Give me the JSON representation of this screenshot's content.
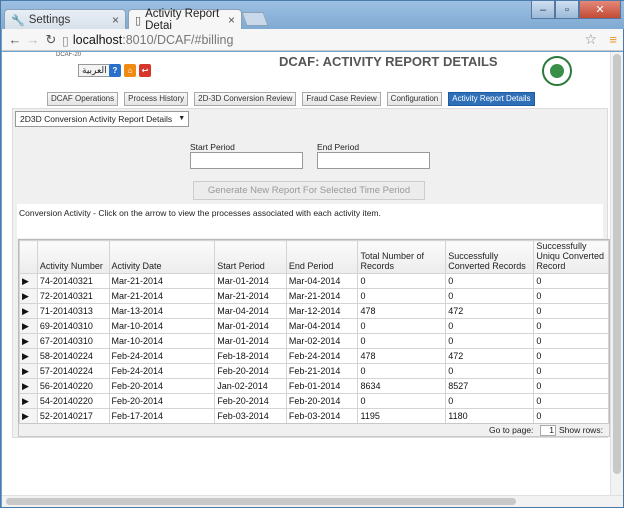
{
  "browser": {
    "tabs": [
      {
        "label": "Settings",
        "icon": "wrench-icon"
      },
      {
        "label": "Activity Report Detai",
        "icon": "page-icon"
      }
    ],
    "url_host": "localhost",
    "url_path": ":8010/DCAF/#billing"
  },
  "header": {
    "app_small": "DCAF-20",
    "lang_button": "العربية",
    "title": "DCAF: ACTIVITY REPORT DETAILS"
  },
  "nav": {
    "items": [
      "DCAF Operations",
      "Process History",
      "2D-3D Conversion Review",
      "Fraud Case Review",
      "Configuration",
      "Activity Report Details"
    ],
    "active": "Activity Report Details"
  },
  "form": {
    "report_type": "2D3D Conversion Activity Report Details",
    "start_label": "Start Period",
    "end_label": "End Period",
    "generate_button": "Generate New Report For Selected Time Period",
    "info_text": "Conversion Activity - Click on the arrow to view the processes associated with each activity item."
  },
  "table": {
    "columns": [
      "Activity Number",
      "Activity Date",
      "Start Period",
      "End Period",
      "Total Number of Records",
      "Successfully Converted Records",
      "Successfully Uniqu Converted Record"
    ],
    "rows": [
      [
        "74-20140321",
        "Mar-21-2014",
        "Mar-01-2014",
        "Mar-04-2014",
        "0",
        "0",
        "0"
      ],
      [
        "72-20140321",
        "Mar-21-2014",
        "Mar-21-2014",
        "Mar-21-2014",
        "0",
        "0",
        "0"
      ],
      [
        "71-20140313",
        "Mar-13-2014",
        "Mar-04-2014",
        "Mar-12-2014",
        "478",
        "472",
        "0"
      ],
      [
        "69-20140310",
        "Mar-10-2014",
        "Mar-01-2014",
        "Mar-04-2014",
        "0",
        "0",
        "0"
      ],
      [
        "67-20140310",
        "Mar-10-2014",
        "Mar-01-2014",
        "Mar-02-2014",
        "0",
        "0",
        "0"
      ],
      [
        "58-20140224",
        "Feb-24-2014",
        "Feb-18-2014",
        "Feb-24-2014",
        "478",
        "472",
        "0"
      ],
      [
        "57-20140224",
        "Feb-24-2014",
        "Feb-20-2014",
        "Feb-21-2014",
        "0",
        "0",
        "0"
      ],
      [
        "56-20140220",
        "Feb-20-2014",
        "Jan-02-2014",
        "Feb-01-2014",
        "8634",
        "8527",
        "0"
      ],
      [
        "54-20140220",
        "Feb-20-2014",
        "Feb-20-2014",
        "Feb-20-2014",
        "0",
        "0",
        "0"
      ],
      [
        "52-20140217",
        "Feb-17-2014",
        "Feb-03-2014",
        "Feb-03-2014",
        "1195",
        "1180",
        "0"
      ]
    ]
  },
  "pager": {
    "goto_label": "Go to page:",
    "page": "1",
    "show_rows_label": "Show rows:"
  },
  "colors": {
    "accent": "#2e6fb8",
    "help": "#2a6fc9",
    "home": "#f08a12",
    "logout": "#d9362b"
  }
}
